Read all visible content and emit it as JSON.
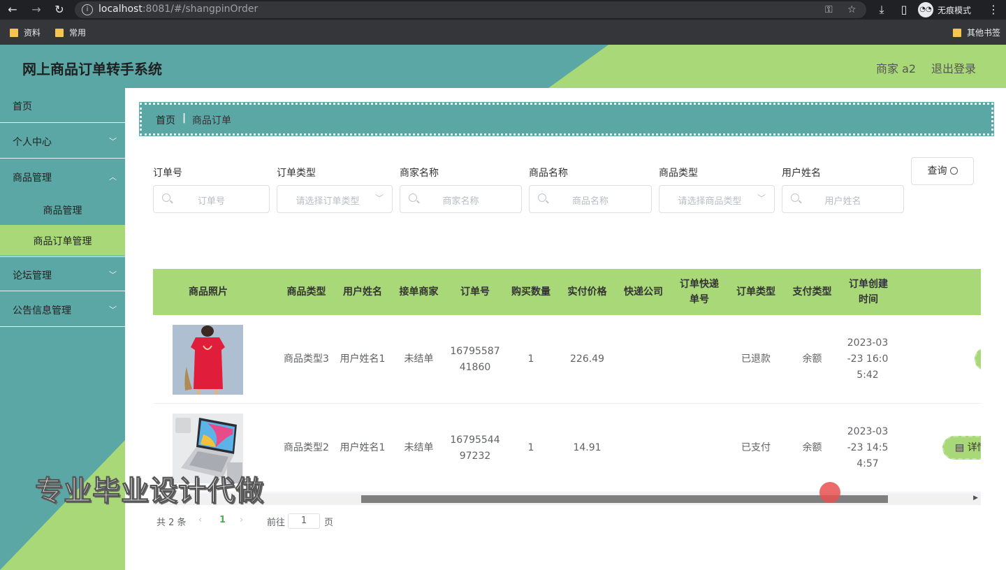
{
  "browser": {
    "url_host": "localhost",
    "url_rest": ":8081/#/shangpinOrder",
    "incognito_label": "无痕模式",
    "bookmarks": [
      "资料",
      "常用"
    ],
    "other_bookmarks": "其他书签"
  },
  "header": {
    "title": "网上商品订单转手系统",
    "user": "商家 a2",
    "logout": "退出登录"
  },
  "sidebar": {
    "items": [
      "首页",
      "个人中心",
      "商品管理",
      "论坛管理",
      "公告信息管理"
    ],
    "subitems": [
      "商品管理",
      "商品订单管理"
    ],
    "active_subitem": "商品订单管理"
  },
  "breadcrumb": {
    "home": "首页",
    "separator": "|",
    "current": "商品订单"
  },
  "filters": {
    "order_no": {
      "label": "订单号",
      "placeholder": "订单号"
    },
    "order_type": {
      "label": "订单类型",
      "placeholder": "请选择订单类型"
    },
    "merchant": {
      "label": "商家名称",
      "placeholder": "商家名称"
    },
    "product": {
      "label": "商品名称",
      "placeholder": "商品名称"
    },
    "product_type": {
      "label": "商品类型",
      "placeholder": "请选择商品类型"
    },
    "user_name": {
      "label": "用户姓名",
      "placeholder": "用户姓名"
    },
    "query_label": "查询"
  },
  "table": {
    "columns": [
      "商品照片",
      "商品类型",
      "用户姓名",
      "接单商家",
      "订单号",
      "购买数量",
      "实付价格",
      "快递公司",
      "订单快递单号",
      "订单类型",
      "支付类型",
      "订单创建时间"
    ],
    "rows": [
      {
        "photo": "red-dress",
        "type": "商品类型3",
        "user": "用户姓名1",
        "merchant": "未结单",
        "order_no": "1679558741860",
        "qty": "1",
        "price": "226.49",
        "courier": "",
        "tracking": "",
        "order_type": "已退款",
        "pay_type": "余额",
        "created": "2023-03-23 16:05:42",
        "action": ""
      },
      {
        "photo": "laptop",
        "type": "商品类型2",
        "user": "用户姓名1",
        "merchant": "未结单",
        "order_no": "1679554497232",
        "qty": "1",
        "price": "14.91",
        "courier": "",
        "tracking": "",
        "order_type": "已支付",
        "pay_type": "余额",
        "created": "2023-03-23 14:54:57",
        "action": "详情"
      }
    ]
  },
  "pagination": {
    "total": "共 2 条",
    "current_page": "1",
    "goto_label": "前往",
    "goto_value": "1",
    "page_suffix": "页"
  },
  "watermark": "专业毕业设计代做",
  "colors": {
    "teal": "#5aa7a5",
    "green": "#a8d878"
  }
}
